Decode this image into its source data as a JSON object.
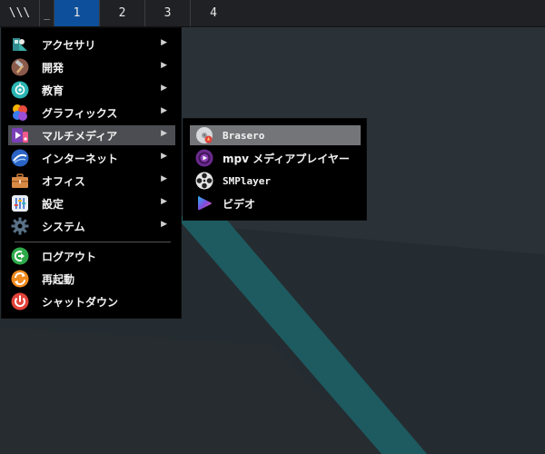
{
  "panel": {
    "launcher_glyph": "\\\\\\",
    "show_desktop_label": "_",
    "workspaces": [
      {
        "label": "1",
        "active": true
      },
      {
        "label": "2",
        "active": false
      },
      {
        "label": "3",
        "active": false
      },
      {
        "label": "4",
        "active": false
      }
    ]
  },
  "main_menu": {
    "items": [
      {
        "label": "アクセサリ",
        "icon": "accessories-icon",
        "submenu": true
      },
      {
        "label": "開発",
        "icon": "hammer-icon",
        "submenu": true
      },
      {
        "label": "教育",
        "icon": "education-icon",
        "submenu": true
      },
      {
        "label": "グラフィックス",
        "icon": "graphics-icon",
        "submenu": true
      },
      {
        "label": "マルチメディア",
        "icon": "multimedia-icon",
        "submenu": true,
        "highlighted": true
      },
      {
        "label": "インターネット",
        "icon": "internet-icon",
        "submenu": true
      },
      {
        "label": "オフィス",
        "icon": "office-icon",
        "submenu": true
      },
      {
        "label": "設定",
        "icon": "settings-icon",
        "submenu": true
      },
      {
        "label": "システム",
        "icon": "system-gear-icon",
        "submenu": true
      }
    ],
    "session_items": [
      {
        "label": "ログアウト",
        "icon": "logout-icon"
      },
      {
        "label": "再起動",
        "icon": "reboot-icon"
      },
      {
        "label": "シャットダウン",
        "icon": "power-icon"
      }
    ],
    "arrow_glyph": "▶"
  },
  "sub_menu": {
    "items": [
      {
        "label": "Brasero",
        "icon": "brasero-disc-icon",
        "highlighted": true
      },
      {
        "label": "mpv メディアプレイヤー",
        "icon": "mpv-icon"
      },
      {
        "label": "SMPlayer",
        "icon": "smplayer-icon"
      },
      {
        "label": "ビデオ",
        "icon": "video-play-icon"
      }
    ]
  },
  "colors": {
    "panel_bg": "#1f2124",
    "active_workspace": "#0d4f9a",
    "menu_bg": "#000000",
    "menu_highlight": "#4c4d52",
    "submenu_highlight": "#747579",
    "desktop_bg": "#242b30",
    "desktop_stripe": "#1f5f63"
  }
}
